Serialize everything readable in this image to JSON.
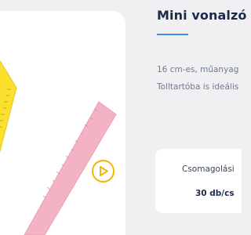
{
  "product": {
    "title": "Mini vonalzó",
    "description_line_1": "16 cm-es, műanyag",
    "description_line_2": "Tolltartóba is ideális",
    "packaging_label": "Csomagolási",
    "packaging_value": "30 db/cs"
  },
  "media": {
    "image_subject": "yellow and pink plastic rulers",
    "video_icon": "play-icon"
  },
  "colors": {
    "page_background": "#f0f0f2",
    "title": "#1c2a4a",
    "accent_underline": "#3a8ee6",
    "play_button": "#f2b705",
    "yellow_ruler": "#fbe12d",
    "pink_ruler": "#f4b3c4"
  }
}
